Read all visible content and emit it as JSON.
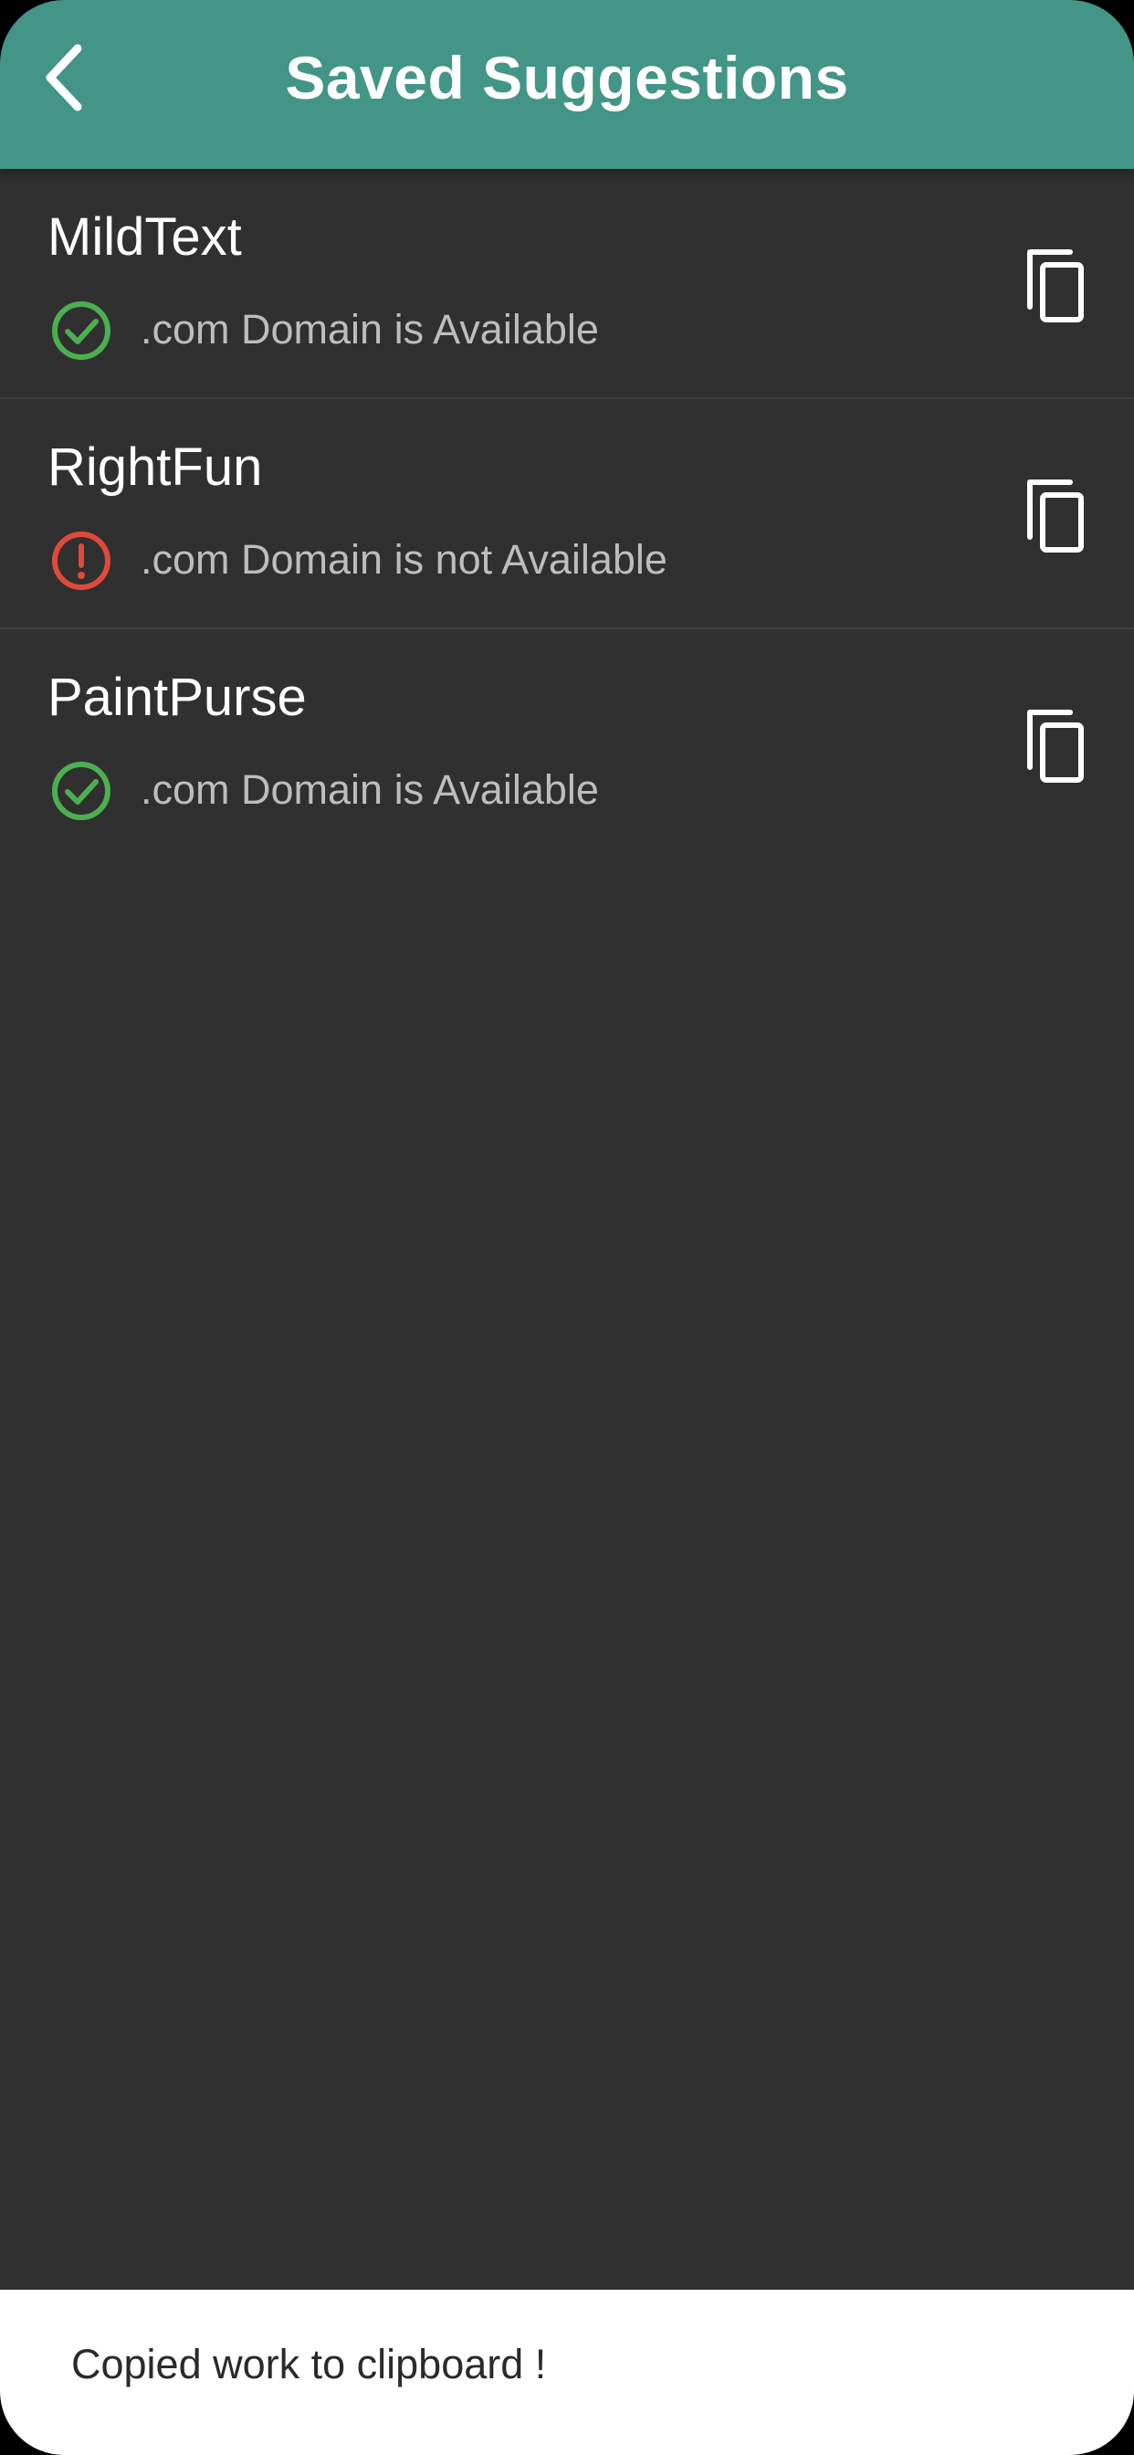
{
  "appbar": {
    "title": "Saved Suggestions",
    "background_color": "#429587",
    "back_icon": "chevron-left-icon"
  },
  "suggestions": [
    {
      "name": "MildText",
      "status_text": ".com Domain is Available",
      "status": "available",
      "status_icon": "check-circle-icon",
      "status_color": "#4caf50",
      "action_icon": "copy-icon"
    },
    {
      "name": "RightFun",
      "status_text": ".com Domain is not Available",
      "status": "not-available",
      "status_icon": "alert-circle-icon",
      "status_color": "#e04a3a",
      "action_icon": "copy-icon"
    },
    {
      "name": "PaintPurse",
      "status_text": ".com Domain is Available",
      "status": "available",
      "status_icon": "check-circle-icon",
      "status_color": "#4caf50",
      "action_icon": "copy-icon"
    }
  ],
  "snackbar": {
    "message": "Copied work to clipboard !"
  }
}
